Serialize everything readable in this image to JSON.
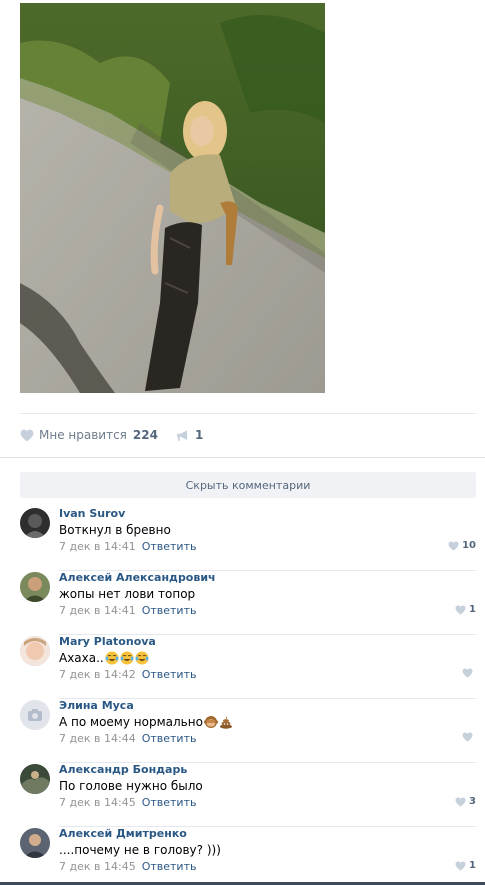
{
  "post": {
    "likes_label": "Мне нравится",
    "likes_count": "224",
    "shares_count": "1",
    "hide_comments_label": "Скрыть комментарии"
  },
  "comments": [
    {
      "author": "Ivan Surov",
      "text": "Воткнул в бревно",
      "emojis": [],
      "date": "7 дек в 14:41",
      "reply": "Ответить",
      "likes": "10"
    },
    {
      "author": "Алексей Александрович",
      "text": "жопы нет лови топор",
      "emojis": [],
      "date": "7 дек в 14:41",
      "reply": "Ответить",
      "likes": "1"
    },
    {
      "author": "Mary Platonova",
      "text": "Ахаха..",
      "emojis": [
        "tears-of-joy",
        "tears-of-joy",
        "tears-of-joy"
      ],
      "date": "7 дек в 14:42",
      "reply": "Ответить",
      "likes": ""
    },
    {
      "author": "Элина Муса",
      "text": "А по моему нормально",
      "emojis": [
        "see-no-evil-monkey",
        "pile-of-poo"
      ],
      "date": "7 дек в 14:44",
      "reply": "Ответить",
      "likes": ""
    },
    {
      "author": "Александр Бондарь",
      "text": "По голове нужно было",
      "emojis": [],
      "date": "7 дек в 14:45",
      "reply": "Ответить",
      "likes": "3"
    },
    {
      "author": "Алексей Дмитренко",
      "text": "....почему не в голову? )))",
      "emojis": [],
      "date": "7 дек в 14:45",
      "reply": "Ответить",
      "likes": "1"
    }
  ],
  "colors": {
    "link": "#2a5885",
    "meta": "#939393",
    "icon": "#c5d0db",
    "button_bg": "#f0f2f5"
  },
  "icons": {
    "like": "heart-icon",
    "share": "megaphone-icon",
    "camera": "camera-icon"
  }
}
